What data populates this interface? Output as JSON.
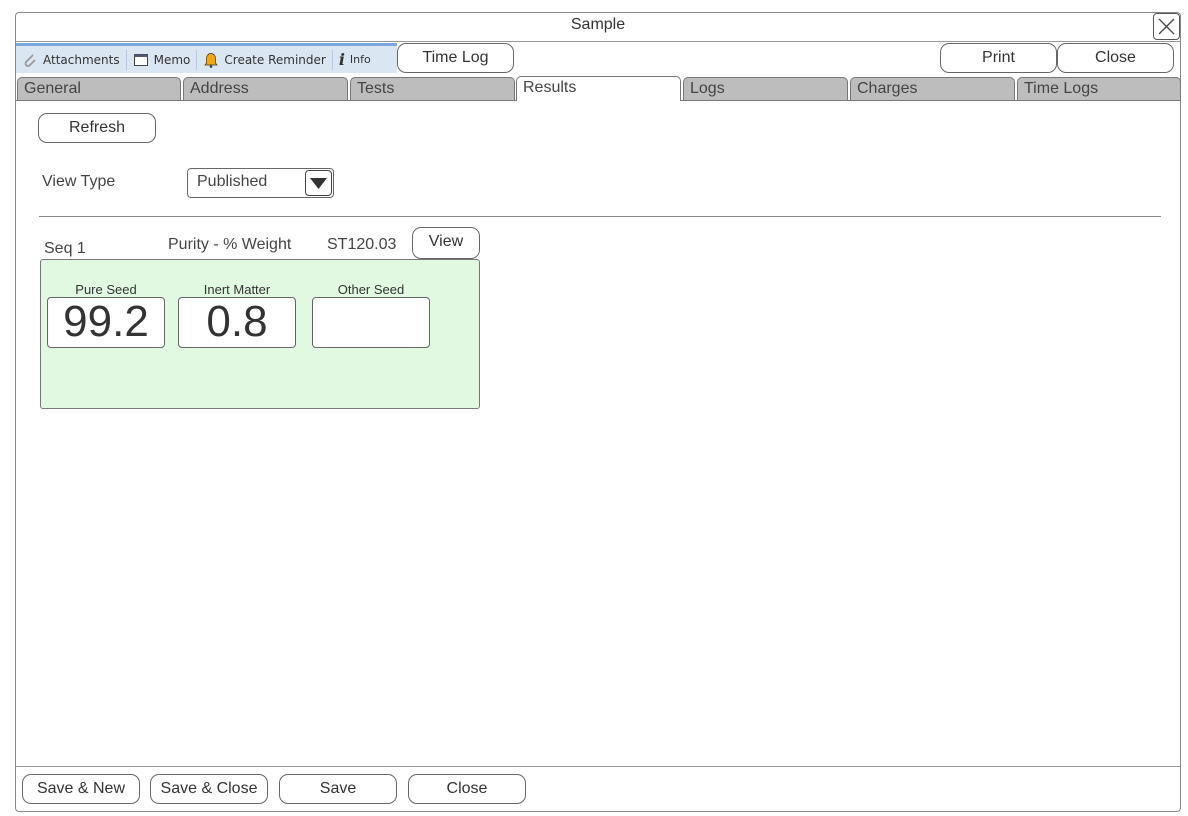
{
  "window": {
    "title": "Sample"
  },
  "toolbar": {
    "attachments": "Attachments",
    "memo": "Memo",
    "reminder": "Create Reminder",
    "info": "Info",
    "time_log": "Time Log",
    "print": "Print",
    "close": "Close"
  },
  "tabs": [
    "General",
    "Address",
    "Tests",
    "Results",
    "Logs",
    "Charges",
    "Time Logs"
  ],
  "results": {
    "refresh": "Refresh",
    "view_type_label": "View Type",
    "view_type_value": "Published",
    "seq": "Seq 1",
    "test_name": "Purity - % Weight",
    "code": "ST120.03",
    "view": "View",
    "fields": [
      {
        "label": "Pure Seed",
        "value": "99.2"
      },
      {
        "label": "Inert Matter",
        "value": "0.8"
      },
      {
        "label": "Other Seed",
        "value": ""
      }
    ]
  },
  "footer": {
    "save_new": "Save & New",
    "save_close": "Save & Close",
    "save": "Save",
    "close": "Close"
  },
  "colors": {
    "panel": "#e1f9e1",
    "toolbar": "#dbe6f3",
    "tab": "#bdbdbd"
  }
}
